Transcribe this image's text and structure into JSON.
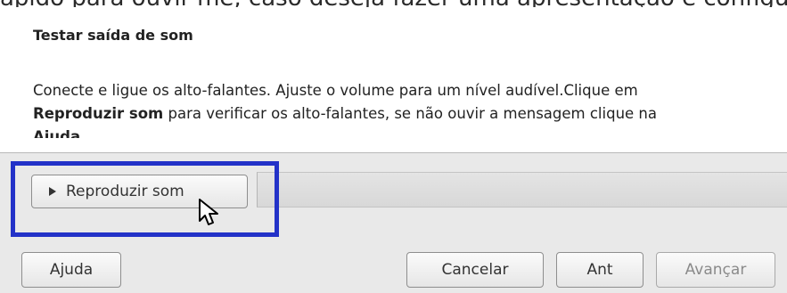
{
  "top_cut_text": "ápido para ouvir-me, caso deseja fazer uma apresentação e configurar a",
  "section_title": "Testar saída de som",
  "description": {
    "part1": "Conecte e ligue os alto-falantes. Ajuste o volume para um nível audível.Clique em",
    "bold1": "Reproduzir som",
    "part2": "para verificar os alto-falantes, se não ouvir a mensagem clique na",
    "bold2": "Ajuda"
  },
  "buttons": {
    "play": "Reproduzir som",
    "help": "Ajuda",
    "cancel": "Cancelar",
    "back": "Ant",
    "next": "Avançar"
  },
  "icons": {
    "play": "play-triangle-icon",
    "cursor": "mouse-pointer-icon"
  },
  "colors": {
    "highlight": "#2332c8",
    "panel": "#e9e9e9"
  }
}
